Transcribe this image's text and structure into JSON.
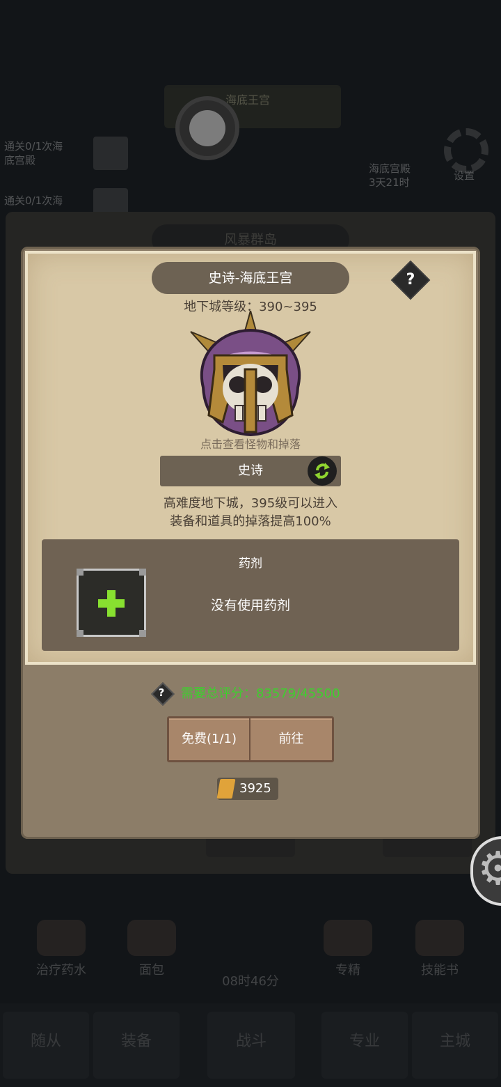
{
  "background": {
    "top_banner": "海底王宫",
    "left_quests": [
      "通关0/1次海\n底宫殿",
      "通关0/1次海"
    ],
    "right_event": "海底宫殿\n3天21时",
    "right_settings": "设置",
    "panel_title": "风暴群岛",
    "items": [
      "治疗药水",
      "面包",
      "08时46分",
      "专精",
      "技能书"
    ],
    "nav_tabs": [
      "随从",
      "装备",
      "战斗",
      "专业",
      "主城"
    ]
  },
  "modal": {
    "title": "史诗-海底王宫",
    "dungeon_level": "地下城等级：390~395",
    "view_hint": "点击查看怪物和掉落",
    "difficulty": "史诗",
    "desc_line1": "高难度地下城，395级可以进入",
    "desc_line2": "装备和道具的掉落提高100%",
    "potion_title": "药剂",
    "no_potion": "没有使用药剂",
    "score_text": "需要总评分：83579/45500",
    "free_label": "免费(1/1)",
    "go_label": "前往",
    "ticket_count": "3925",
    "help_label": "?"
  },
  "colors": {
    "score_green": "#3ecf2e",
    "panel_brown": "#6f6253",
    "parchment": "#d8c8a6",
    "plus_green": "#88e030"
  }
}
